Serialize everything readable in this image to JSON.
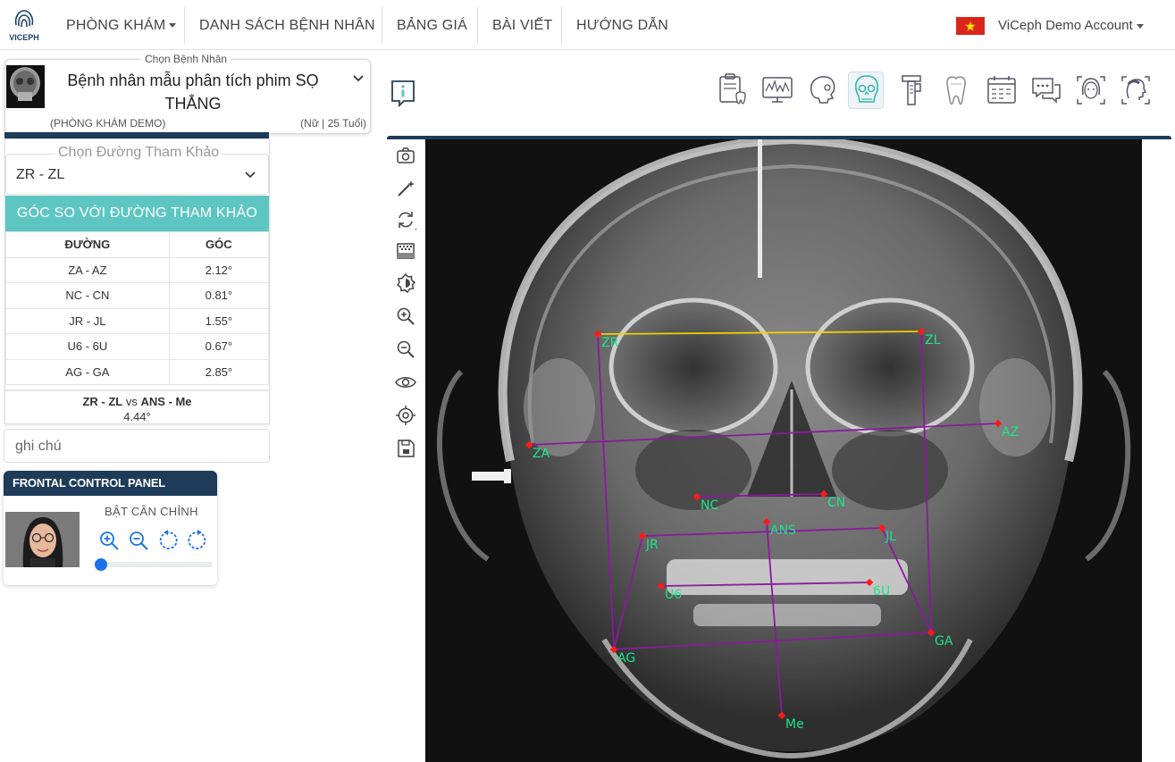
{
  "navbar": {
    "logo_text": "VICEPH",
    "items": [
      {
        "label": "PHÒNG KHÁM"
      },
      {
        "label": "DANH SÁCH BỆNH NHÂN"
      },
      {
        "label": "BẢNG GIÁ"
      },
      {
        "label": "BÀI VIẾT"
      },
      {
        "label": "HƯỚNG DẪN"
      }
    ],
    "account": "ViCeph Demo Account"
  },
  "patient": {
    "legend": "Chọn Bệnh Nhân",
    "name": "Bệnh nhân mẫu phân tích phim SỌ THẲNG",
    "clinic": "(PHÒNG KHÁM DEMO)",
    "info": "(Nữ | 25 Tuổi)"
  },
  "reference": {
    "legend": "Chọn Đường Tham Khảo",
    "selected": "ZR - ZL",
    "header": "GÓC SO VỚI ĐƯỜNG THAM KHẢO",
    "columns": [
      "ĐƯỜNG",
      "GÓC"
    ],
    "rows": [
      {
        "line": "ZA - AZ",
        "angle": "2.12°"
      },
      {
        "line": "NC - CN",
        "angle": "0.81°"
      },
      {
        "line": "JR - JL",
        "angle": "1.55°"
      },
      {
        "line": "U6 - 6U",
        "angle": "0.67°"
      },
      {
        "line": "AG - GA",
        "angle": "2.85°"
      }
    ],
    "vs_a": "ZR - ZL",
    "vs_word": " vs ",
    "vs_b": "ANS - Me",
    "vs_value": "4.44°"
  },
  "note": {
    "placeholder": "ghi chú"
  },
  "control_panel": {
    "title": "FRONTAL CONTROL PANEL",
    "calibrate_label": "BẬT CÂN CHỈNH",
    "slider_value": 0
  },
  "landmarks": [
    {
      "id": "ZR",
      "label": "ZR"
    },
    {
      "id": "ZL",
      "label": "ZL"
    },
    {
      "id": "ZA",
      "label": "ZA"
    },
    {
      "id": "AZ",
      "label": "AZ"
    },
    {
      "id": "NC",
      "label": "NC"
    },
    {
      "id": "CN",
      "label": "CN"
    },
    {
      "id": "ANS",
      "label": "ANS"
    },
    {
      "id": "JR",
      "label": "JR"
    },
    {
      "id": "JL",
      "label": "JL"
    },
    {
      "id": "U6",
      "label": "U6"
    },
    {
      "id": "6U",
      "label": "6U"
    },
    {
      "id": "AG",
      "label": "AG"
    },
    {
      "id": "GA",
      "label": "GA"
    },
    {
      "id": "Me",
      "label": "Me"
    }
  ],
  "colors": {
    "navy": "#1e3c5a",
    "teal": "#5ec6c2",
    "point": "#ff1a1a",
    "label": "#19e68c",
    "line": "#8b1a9e",
    "reference_line": "#f0d000"
  }
}
